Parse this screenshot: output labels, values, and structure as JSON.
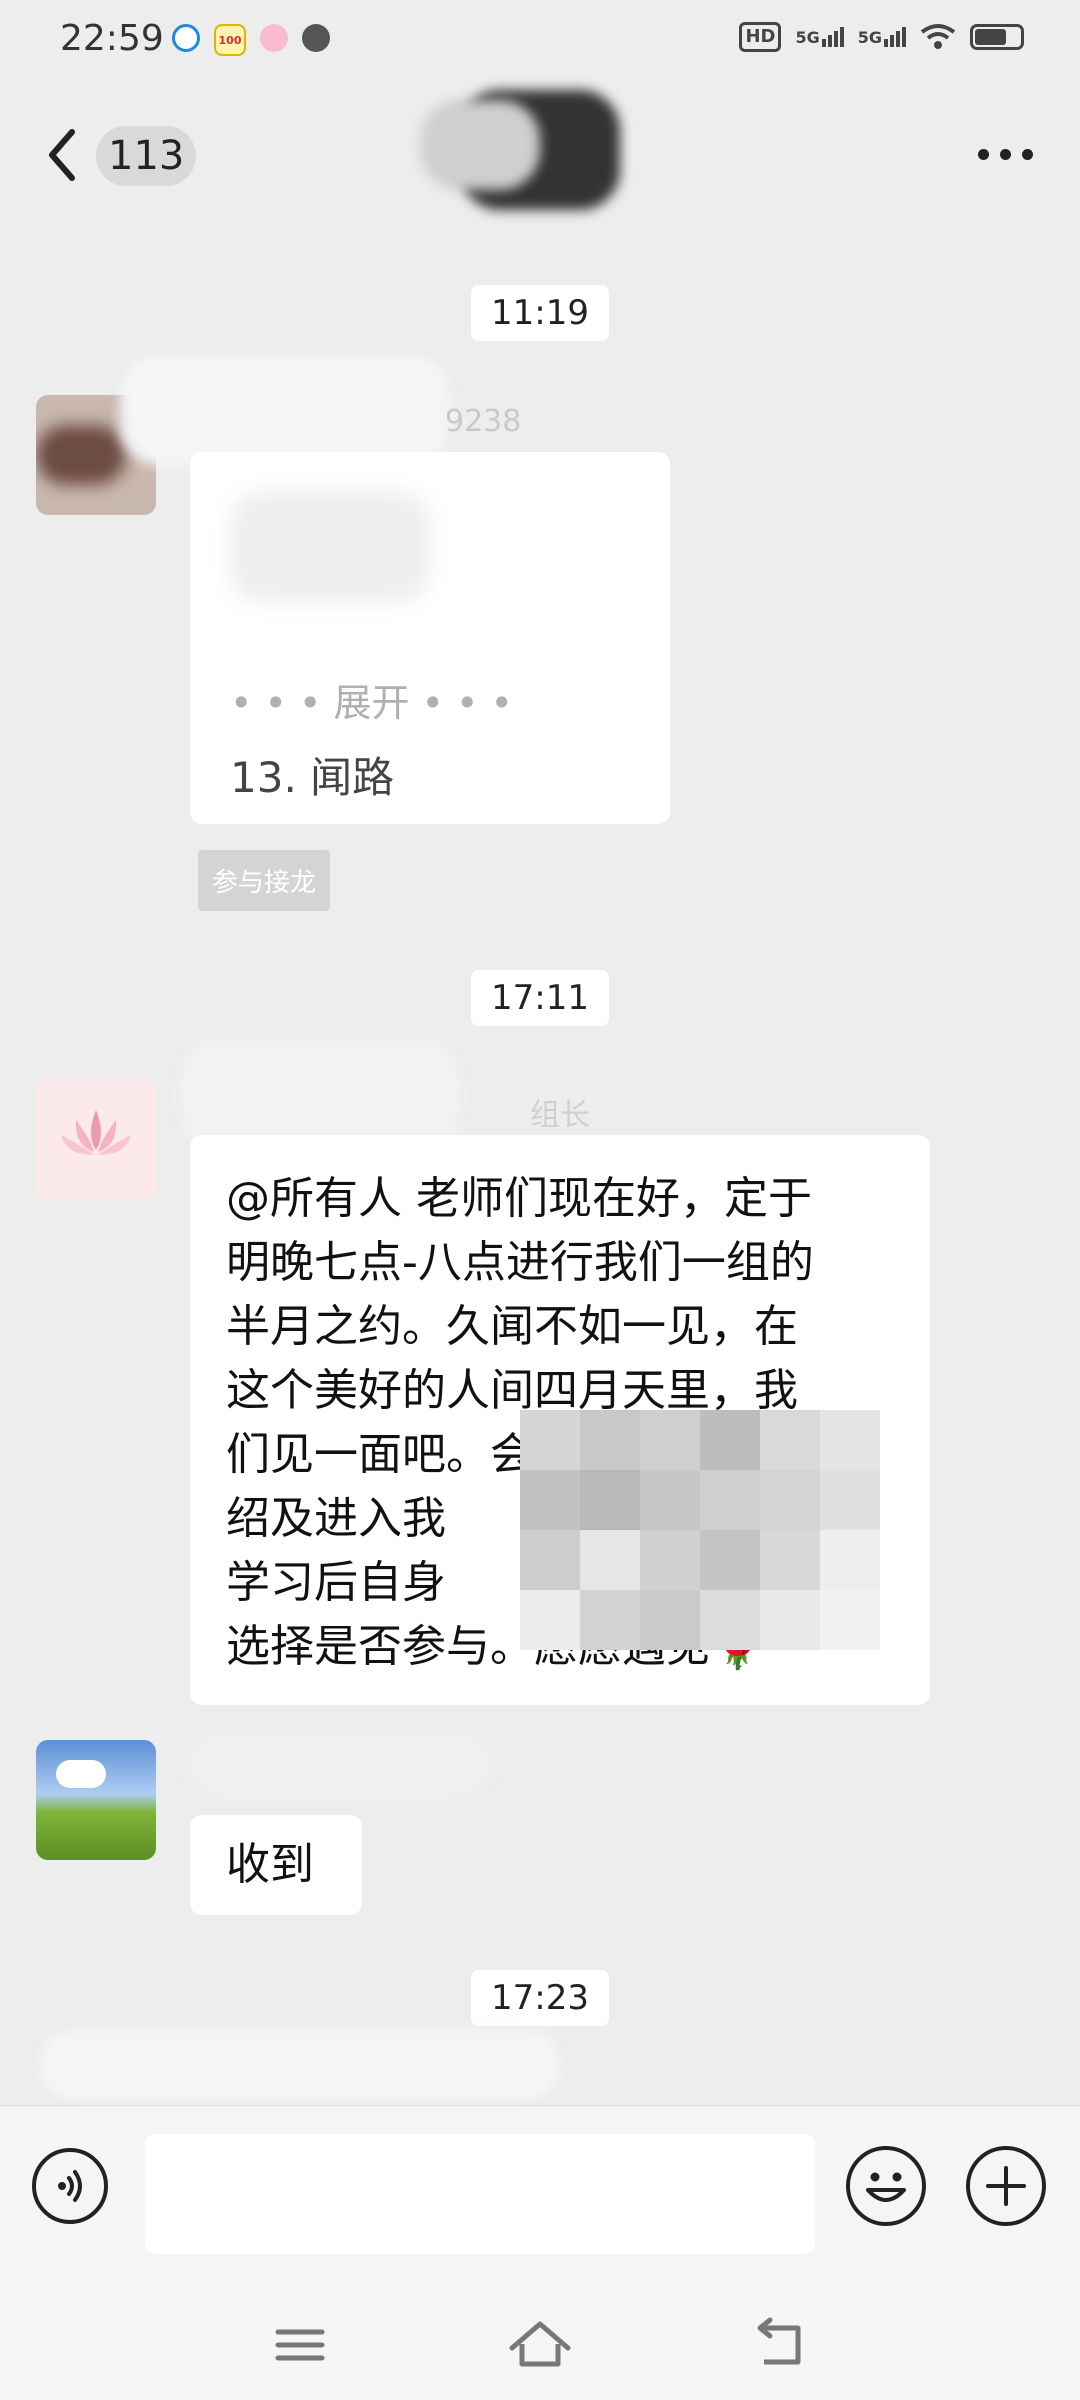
{
  "status_bar": {
    "time": "22:59",
    "network_1": "5G",
    "network_2": "5G",
    "hd_label": "HD",
    "app_icons": [
      "browser-icon",
      "app-100-icon",
      "camera-app-icon",
      "avatar-app-icon"
    ]
  },
  "header": {
    "unread_count": "113"
  },
  "messages": [
    {
      "type": "time",
      "text": "11:19"
    },
    {
      "type": "message",
      "sender_partial": "9238",
      "card_line_1": "• • • 展开 • • •",
      "card_line_2": "13. 闻路",
      "action_chip": "参与接龙"
    },
    {
      "type": "time",
      "text": "17:11"
    },
    {
      "type": "message",
      "sender_partial": "组长",
      "lines": [
        "@所有人  老师们现在好，定于",
        "明晚七点-八点进行我们一组的",
        "半月之约。久闻不如一见，在",
        "这个美好的人间四月天里，我",
        "们见一面吧。会议主题",
        "绍及进入我",
        "学习后自身",
        "选择是否参与。愿愿遇见🌹"
      ]
    },
    {
      "type": "message",
      "sender_partial": "",
      "text": "收到"
    },
    {
      "type": "time",
      "text": "17:23"
    }
  ],
  "input": {
    "value": "",
    "placeholder": ""
  },
  "icons": {
    "voice": "voice-icon",
    "emoji": "emoji-icon",
    "plus": "plus-icon",
    "back": "back-arrow-icon",
    "more": "more-icon"
  },
  "colors": {
    "background": "#ededed",
    "bubble": "#ffffff",
    "time_pill": "#ffffff"
  }
}
